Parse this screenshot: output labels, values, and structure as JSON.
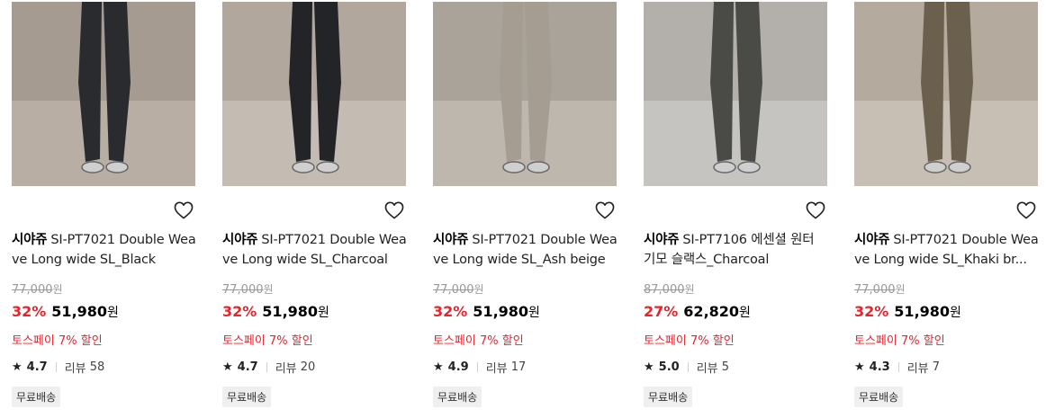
{
  "products": [
    {
      "brand": "시야쥬",
      "name": "SI-PT7021 Double Weave Long wide SL_Black",
      "original_price": "77,000",
      "discount": "32%",
      "price": "51,980",
      "currency": "원",
      "promo": "토스페이 7% 할인",
      "rating": "4.7",
      "review_label": "리뷰",
      "review_count": "58",
      "shipping": "무료배송",
      "pants_color": "#2a2b2e",
      "bg_color": "#b8aea4",
      "wall_color": "#a59b91"
    },
    {
      "brand": "시야쥬",
      "name": "SI-PT7021 Double Weave Long wide SL_Charcoal",
      "original_price": "77,000",
      "discount": "32%",
      "price": "51,980",
      "currency": "원",
      "promo": "토스페이 7% 할인",
      "rating": "4.7",
      "review_label": "리뷰",
      "review_count": "20",
      "shipping": "무료배송",
      "pants_color": "#232428",
      "bg_color": "#c4bbb2",
      "wall_color": "#b1a79d"
    },
    {
      "brand": "시야쥬",
      "name": "SI-PT7021 Double Weave Long wide SL_Ash beige",
      "original_price": "77,000",
      "discount": "32%",
      "price": "51,980",
      "currency": "원",
      "promo": "토스페이 7% 할인",
      "rating": "4.9",
      "review_label": "리뷰",
      "review_count": "17",
      "shipping": "무료배송",
      "pants_color": "#a69d92",
      "bg_color": "#bdb7ae",
      "wall_color": "#a9a39a"
    },
    {
      "brand": "시야쥬",
      "name": "SI-PT7106 에센셜 원터 기모 슬랙스_Charcoal",
      "original_price": "87,000",
      "discount": "27%",
      "price": "62,820",
      "currency": "원",
      "promo": "토스페이 7% 할인",
      "rating": "5.0",
      "review_label": "리뷰",
      "review_count": "5",
      "shipping": "무료배송",
      "pants_color": "#4a4b47",
      "bg_color": "#c6c4c0",
      "wall_color": "#b3b0ab"
    },
    {
      "brand": "시야쥬",
      "name": "SI-PT7021 Double Weave Long wide SL_Khaki br...",
      "original_price": "77,000",
      "discount": "32%",
      "price": "51,980",
      "currency": "원",
      "promo": "토스페이 7% 할인",
      "rating": "4.3",
      "review_label": "리뷰",
      "review_count": "7",
      "shipping": "무료배송",
      "pants_color": "#6b5f4e",
      "bg_color": "#c7bfb4",
      "wall_color": "#b4aa9e"
    }
  ]
}
